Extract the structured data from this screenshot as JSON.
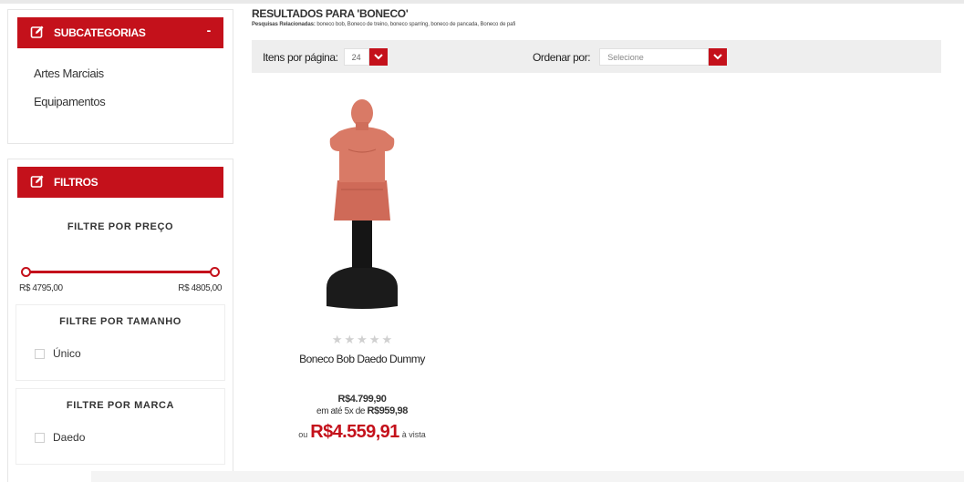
{
  "sidebar": {
    "subcategories": {
      "title": "SUBCATEGORIAS",
      "collapse_symbol": "-",
      "items": [
        "Artes Marciais",
        "Equipamentos"
      ]
    },
    "filters": {
      "title": "FILTROS",
      "price": {
        "title": "FILTRE POR PREÇO",
        "min_label": "R$ 4795,00",
        "max_label": "R$ 4805,00"
      },
      "size": {
        "title": "FILTRE POR TAMANHO",
        "options": [
          "Único"
        ]
      },
      "brand": {
        "title": "FILTRE POR MARCA",
        "options": [
          "Daedo"
        ]
      }
    }
  },
  "main": {
    "results_title": "RESULTADOS PARA 'BONECO'",
    "related_label": "Pesquisas Relacionadas:",
    "related_terms": "boneco bob, Boneco de treino, boneco sparring, boneco de pancada, Boneco de pafi",
    "toolbar": {
      "per_page_label": "Itens por página:",
      "per_page_value": "24",
      "sort_label": "Ordenar por:",
      "sort_placeholder": "Selecione"
    },
    "product": {
      "name": "Boneco Bob Daedo Dummy",
      "rating": 0,
      "price_old": "R$4.799,90",
      "installment_prefix": "em até 5x de",
      "installment_value": "R$959,98",
      "price_prefix": "ou",
      "price_now": "R$4.559,91",
      "price_suffix": "à vista"
    }
  },
  "colors": {
    "brand_red": "#c4111b",
    "toolbar_bg": "#eeeeee"
  },
  "icons": {
    "header_icon": "edit-square-icon",
    "dropdown_icon": "chevron-down-icon",
    "star_icon": "star-icon"
  }
}
